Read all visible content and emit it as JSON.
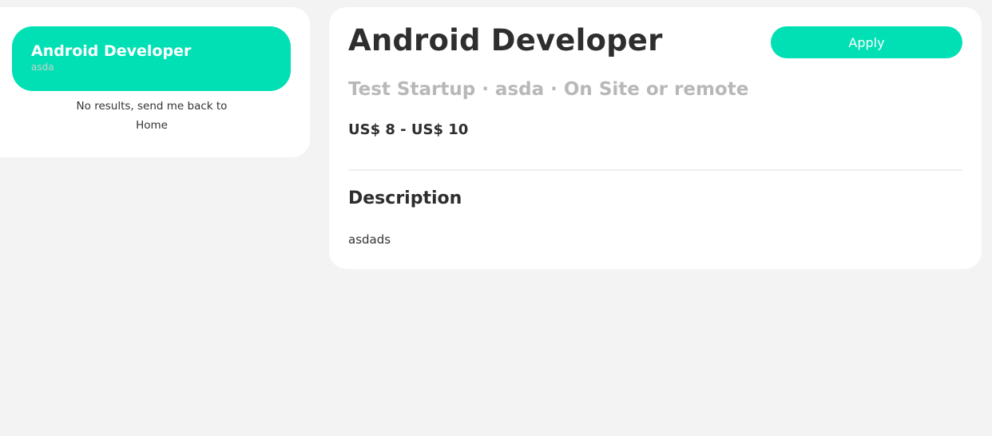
{
  "sidebar": {
    "job_item": {
      "title": "Android Developer",
      "subtitle": "asda"
    },
    "no_results_text": "No results, send me back to",
    "home_link_label": "Home"
  },
  "detail": {
    "title": "Android Developer",
    "apply_label": "Apply",
    "meta": "Test Startup · asda · On Site or remote",
    "salary": "US$ 8 - US$ 10",
    "description_heading": "Description",
    "description_body": "asdads"
  },
  "colors": {
    "accent": "#00e0b4",
    "background": "#f3f3f3",
    "card": "#ffffff",
    "muted_text": "#b8b8b8",
    "text": "#2e2e2e"
  }
}
